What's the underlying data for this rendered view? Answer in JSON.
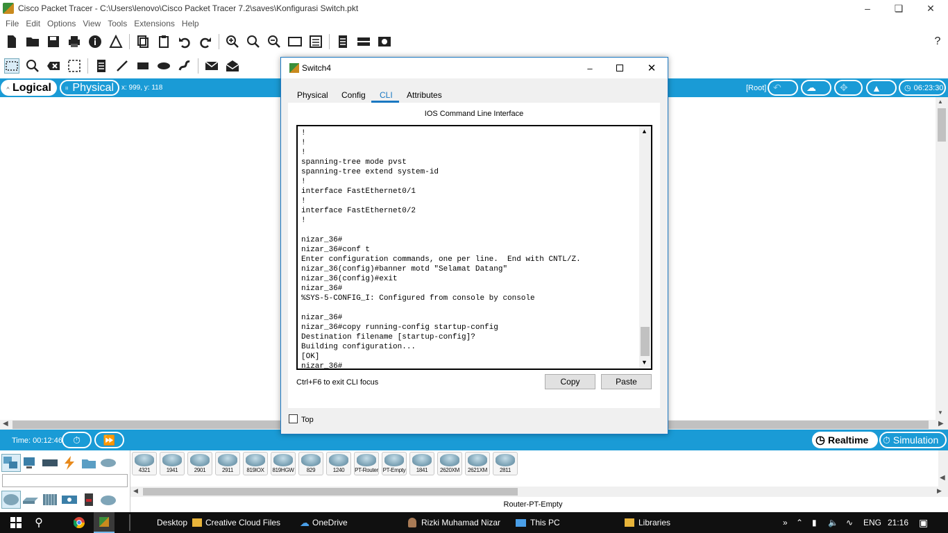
{
  "window": {
    "title": "Cisco Packet Tracer - C:\\Users\\lenovo\\Cisco Packet Tracer 7.2\\saves\\Konfigurasi Switch.pkt"
  },
  "menu": [
    "File",
    "Edit",
    "Options",
    "View",
    "Tools",
    "Extensions",
    "Help"
  ],
  "toolbar_help": "?",
  "modebar": {
    "logical_label": "Logical",
    "physical_label": "Physical",
    "coords": "x: 999, y: 118",
    "root_label": "[Root]",
    "clock": "06:23:30"
  },
  "timebar": {
    "time": "Time: 00:12:46",
    "realtime_label": "Realtime",
    "simulation_label": "Simulation"
  },
  "devices": {
    "routers": [
      "4321",
      "1941",
      "2901",
      "2911",
      "819IOX",
      "819HGW",
      "829",
      "1240",
      "PT-Router",
      "PT-Empty",
      "1841",
      "2620XM",
      "2621XM",
      "2811"
    ],
    "selected_label": "Router-PT-Empty"
  },
  "dialog": {
    "title": "Switch4",
    "tabs": [
      "Physical",
      "Config",
      "CLI",
      "Attributes"
    ],
    "active_tab": "CLI",
    "heading": "IOS Command Line Interface",
    "terminal_text": "!\n!\n!\nspanning-tree mode pvst\nspanning-tree extend system-id\n!\ninterface FastEthernet0/1\n!\ninterface FastEthernet0/2\n!\n\nnizar_36#\nnizar_36#conf t\nEnter configuration commands, one per line.  End with CNTL/Z.\nnizar_36(config)#banner motd \"Selamat Datang\"\nnizar_36(config)#exit\nnizar_36#\n%SYS-5-CONFIG_I: Configured from console by console\n\nnizar_36#\nnizar_36#copy running-config startup-config\nDestination filename [startup-config]?\nBuilding configuration...\n[OK]\nnizar_36#",
    "hint": "Ctrl+F6 to exit CLI focus",
    "copy_label": "Copy",
    "paste_label": "Paste",
    "top_label": "Top"
  },
  "taskbar": {
    "desktop": "Desktop",
    "items": [
      "Creative Cloud Files",
      "OneDrive",
      "Rizki Muhamad Nizar",
      "This PC",
      "Libraries"
    ],
    "lang": "ENG",
    "time": "21:16"
  },
  "colors": {
    "accent": "#1a9bd6",
    "dialog_border": "#1a78c2",
    "cli_tab": "#1a78c2"
  }
}
